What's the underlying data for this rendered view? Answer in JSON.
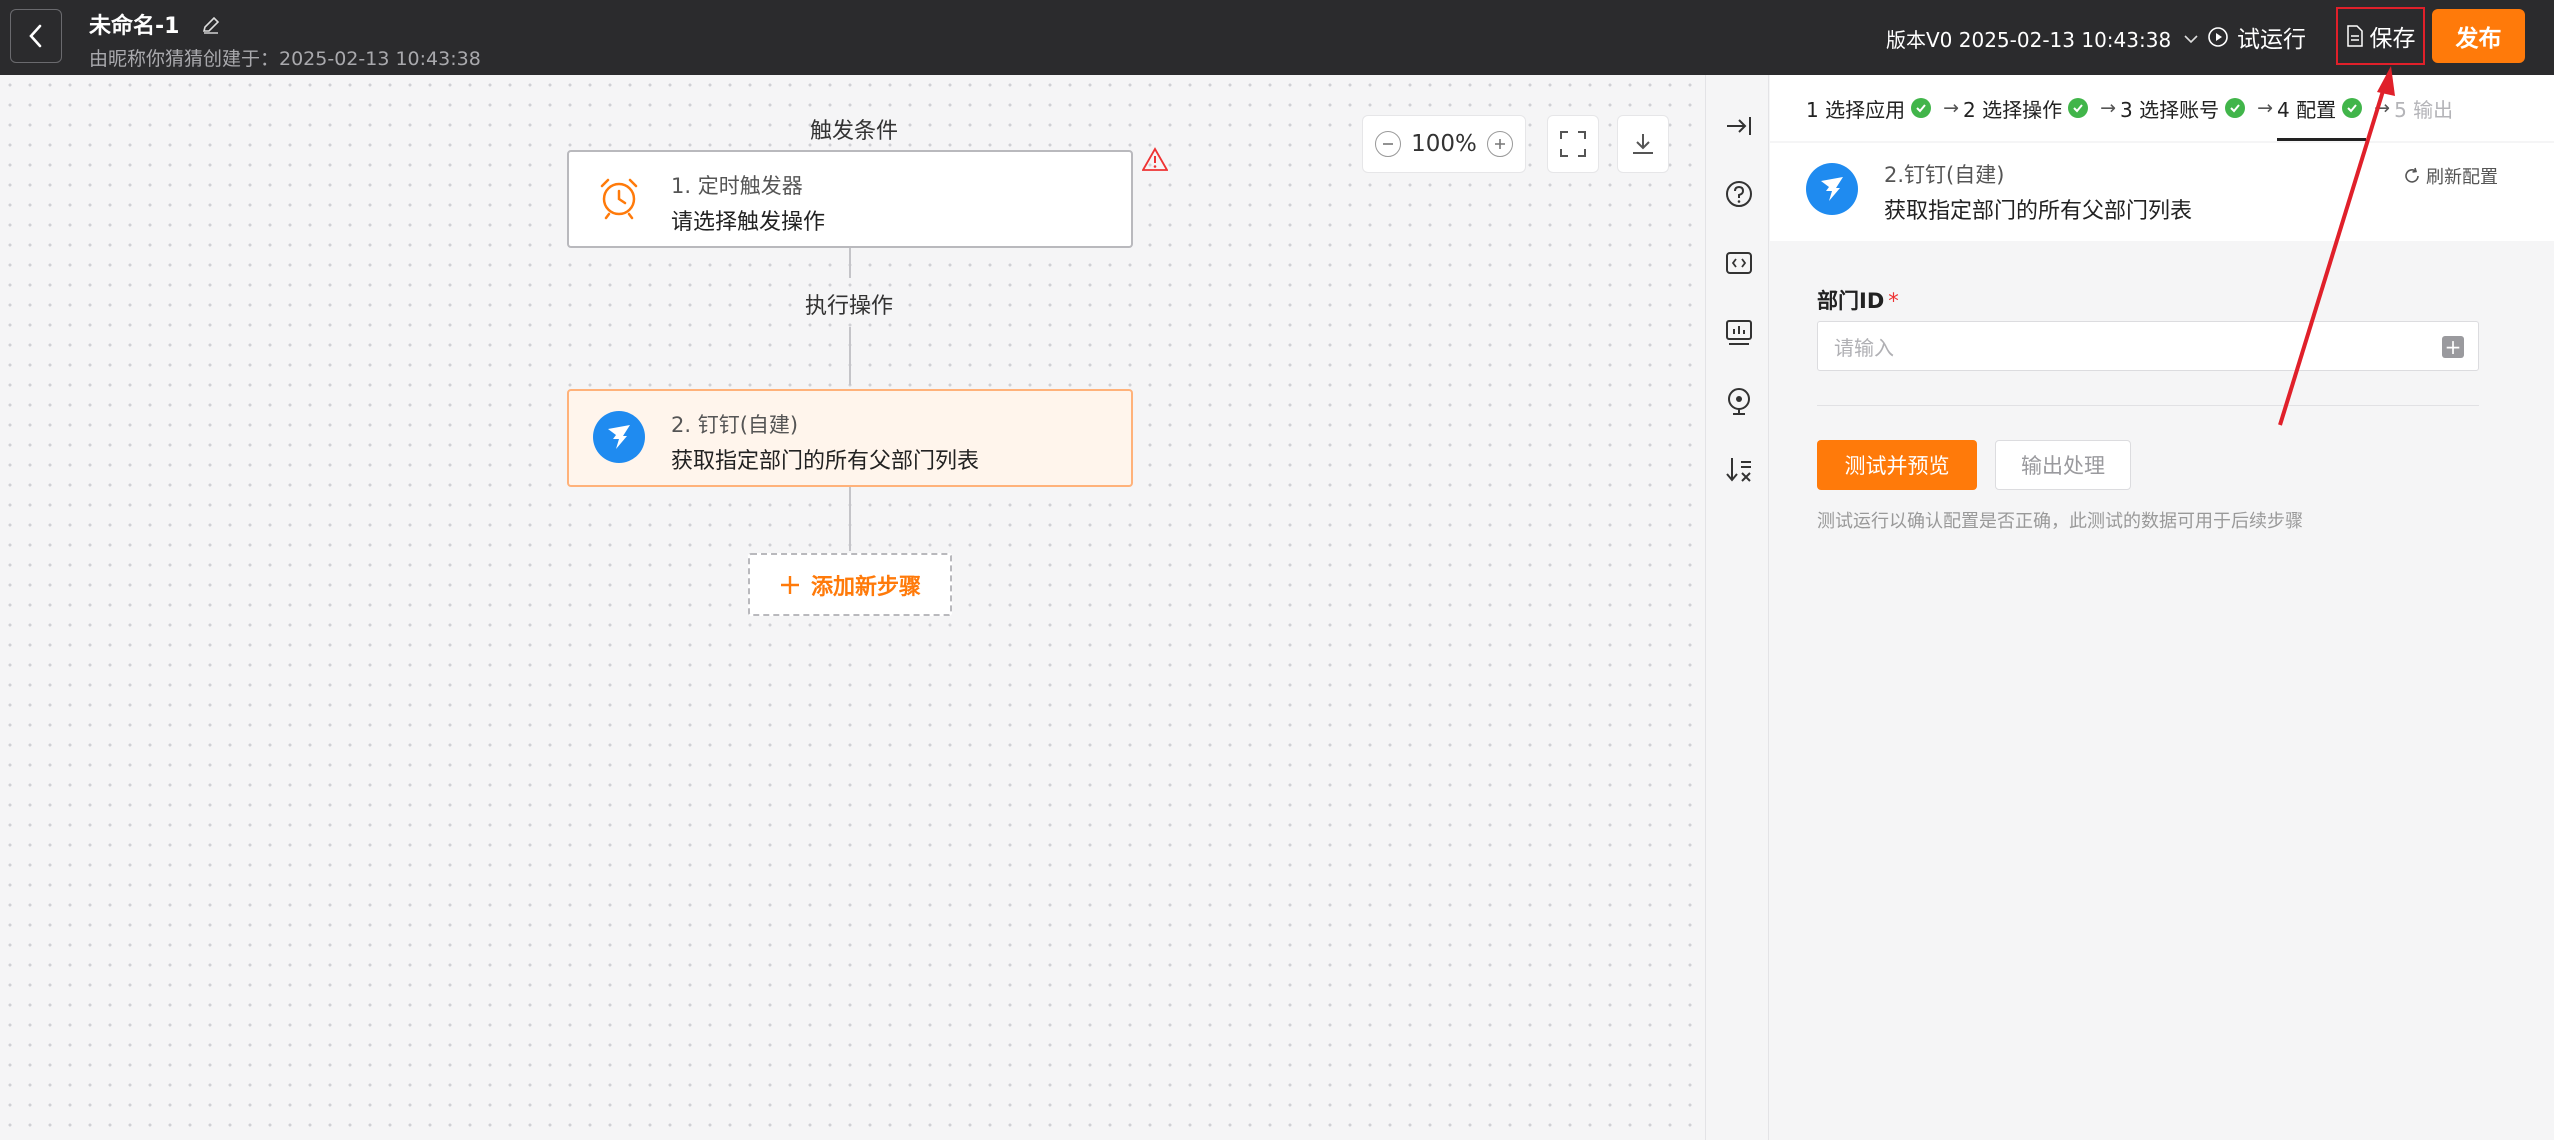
{
  "header": {
    "title": "未命名-1",
    "subtitle": "由昵称你猜猜创建于：2025-02-13 10:43:38",
    "version": "版本V0 2025-02-13 10:43:38",
    "run_label": "试运行",
    "save_label": "保存",
    "publish_label": "发布"
  },
  "canvas": {
    "trigger_title": "触发条件",
    "exec_title": "执行操作",
    "zoom": "100%",
    "add_step_label": "添加新步骤",
    "nodes": [
      {
        "step": "1. 定时触发器",
        "desc": "请选择触发操作"
      },
      {
        "step": "2. 钉钉(自建)",
        "desc": "获取指定部门的所有父部门列表"
      }
    ]
  },
  "panel": {
    "steps": [
      {
        "label": "1 选择应用",
        "done": true
      },
      {
        "label": "2 选择操作",
        "done": true
      },
      {
        "label": "3 选择账号",
        "done": true
      },
      {
        "label": "4 配置",
        "done": true
      },
      {
        "label": "5 输出",
        "done": false
      }
    ],
    "app_step": "2.钉钉(自建)",
    "app_desc": "获取指定部门的所有父部门列表",
    "refresh_label": "刷新配置",
    "field_label": "部门ID",
    "field_required": "*",
    "field_placeholder": "请输入",
    "test_label": "测试并预览",
    "output_label": "输出处理",
    "hint": "测试运行以确认配置是否正确，此测试的数据可用于后续步骤"
  },
  "colors": {
    "accent": "#ff7a0a",
    "header_bg": "#2b2b2d",
    "success": "#41b54a",
    "dingtalk_blue": "#1f8bf0",
    "annotation_red": "#e0202a"
  }
}
